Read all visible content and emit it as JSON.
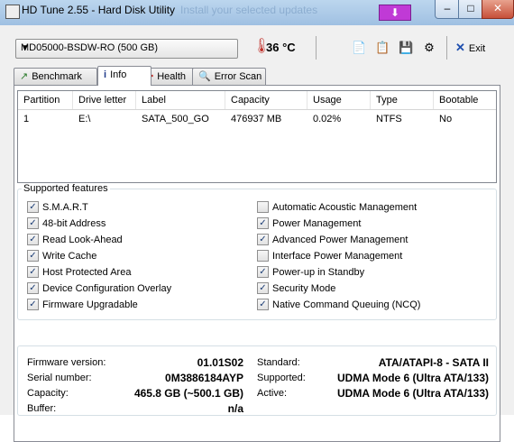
{
  "titlebar": {
    "title": "HD Tune 2.55 - Hard Disk Utility",
    "ghost_text": "Install your selected updates",
    "minimize": "–",
    "maximize": "□",
    "close": "✕",
    "download_icon": "download-arrow-icon"
  },
  "toolbar": {
    "drive": "MD05000-BSDW-RO (500 GB)",
    "temperature": "36 °C",
    "exit_label": "Exit"
  },
  "tabs": [
    {
      "label": "Benchmark",
      "icon": "benchmark-icon"
    },
    {
      "label": "Info",
      "icon": "info-icon"
    },
    {
      "label": "Health",
      "icon": "health-icon"
    },
    {
      "label": "Error Scan",
      "icon": "error-scan-icon"
    }
  ],
  "partitions": {
    "headers": [
      "Partition",
      "Drive letter",
      "Label",
      "Capacity",
      "Usage",
      "Type",
      "Bootable"
    ],
    "rows": [
      [
        "1",
        "E:\\",
        "SATA_500_GO",
        "476937 MB",
        "0.02%",
        "NTFS",
        "No"
      ]
    ]
  },
  "features": {
    "title": "Supported features",
    "left": [
      {
        "label": "S.M.A.R.T",
        "checked": true
      },
      {
        "label": "48-bit Address",
        "checked": true
      },
      {
        "label": "Read Look-Ahead",
        "checked": true
      },
      {
        "label": "Write Cache",
        "checked": true
      },
      {
        "label": "Host Protected Area",
        "checked": true
      },
      {
        "label": "Device Configuration Overlay",
        "checked": true
      },
      {
        "label": "Firmware Upgradable",
        "checked": true
      }
    ],
    "right": [
      {
        "label": "Automatic Acoustic Management",
        "checked": false
      },
      {
        "label": "Power Management",
        "checked": true
      },
      {
        "label": "Advanced Power Management",
        "checked": true
      },
      {
        "label": "Interface Power Management",
        "checked": false
      },
      {
        "label": "Power-up in Standby",
        "checked": true
      },
      {
        "label": "Security Mode",
        "checked": true
      },
      {
        "label": "Native Command Queuing (NCQ)",
        "checked": true
      }
    ]
  },
  "details": {
    "firmware_label": "Firmware version:",
    "firmware": "01.01S02",
    "serial_label": "Serial number:",
    "serial": "0M3886184AYP",
    "capacity_label": "Capacity:",
    "capacity": "465.8 GB (~500.1 GB)",
    "buffer_label": "Buffer:",
    "buffer": "n/a",
    "standard_label": "Standard:",
    "standard": "ATA/ATAPI-8 - SATA II",
    "supported_label": "Supported:",
    "supported": "UDMA Mode 6 (Ultra ATA/133)",
    "active_label": "Active:",
    "active": "UDMA Mode 6 (Ultra ATA/133)"
  }
}
